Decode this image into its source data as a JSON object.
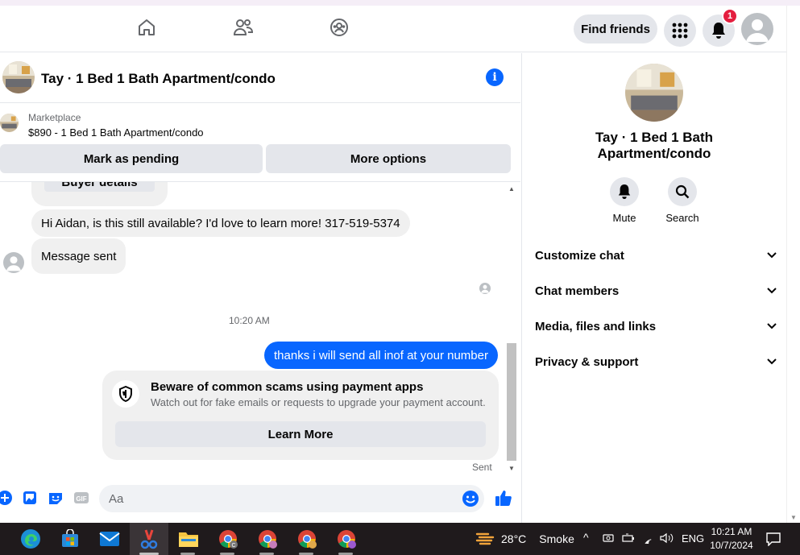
{
  "navbar": {
    "find_friends_label": "Find friends",
    "notification_count": "1"
  },
  "chat": {
    "title": "Tay · 1 Bed 1 Bath Apartment/condo",
    "info_icon": "i"
  },
  "marketplace": {
    "label": "Marketplace",
    "listing": "$890 - 1 Bed 1 Bath Apartment/condo",
    "mark_pending_label": "Mark as pending",
    "more_options_label": "More options"
  },
  "messages": {
    "buyer_details_label": "Buyer details",
    "incoming_1": "Hi Aidan, is this still available? I'd love to learn more! 317-519-5374",
    "incoming_2": "Message sent",
    "timestamp": "10:20 AM",
    "outgoing_1": "thanks i will send all inof at your number",
    "scam_title": "Beware of common scams using payment apps",
    "scam_subtitle": "Watch out for fake emails or requests to upgrade your payment account.",
    "learn_more_label": "Learn More",
    "status": "Sent"
  },
  "composer": {
    "placeholder": "Aa"
  },
  "right_panel": {
    "title": "Tay · 1 Bed 1 Bath Apartment/condo",
    "mute_label": "Mute",
    "search_label": "Search",
    "sections": [
      {
        "label": "Customize chat"
      },
      {
        "label": "Chat members"
      },
      {
        "label": "Media, files and links"
      },
      {
        "label": "Privacy & support"
      }
    ]
  },
  "taskbar": {
    "temperature": "28°C",
    "weather_condition": "Smoke",
    "language": "ENG",
    "time": "10:21 AM",
    "date": "10/7/2024"
  },
  "colors": {
    "accent_blue": "#0866ff",
    "badge_red": "#e41e3f",
    "bubble_gray": "#f0f0f0",
    "button_gray": "#e4e6eb",
    "taskbar_bg": "#1f1a1c"
  }
}
